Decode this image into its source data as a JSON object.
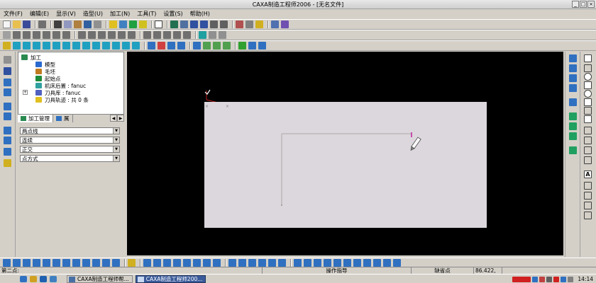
{
  "window": {
    "title": "CAXA制造工程师2006 - [无名文件]"
  },
  "menu": [
    "文件(F)",
    "编辑(E)",
    "显示(V)",
    "造型(U)",
    "加工(N)",
    "工具(T)",
    "设置(S)",
    "帮助(H)"
  ],
  "tree": {
    "root": "加工",
    "items": [
      {
        "label": "模型",
        "icon": "model-icon",
        "color": "#2a6ad0"
      },
      {
        "label": "毛坯",
        "icon": "blank-icon",
        "color": "#c07b20"
      },
      {
        "label": "起始点",
        "icon": "start-point-icon",
        "color": "#1e8a3a"
      },
      {
        "label": "机床后置 : fanuc",
        "icon": "machine-post-icon",
        "color": "#30a0a0"
      },
      {
        "label": "刀具库 : fanuc",
        "icon": "tool-library-icon",
        "color": "#5060c0"
      },
      {
        "label": "刀具轨迹 : 共 0 条",
        "icon": "toolpath-icon",
        "color": "#e0c020"
      }
    ],
    "tabs": [
      "加工管理",
      "属"
    ]
  },
  "options": {
    "line_type": "两点线",
    "mode": "连续",
    "constraint": "正交",
    "method": "点方式"
  },
  "statusbar": {
    "prompt": "第二点:",
    "hint": "操作指导",
    "point_mode": "缺省点",
    "coords": "86.422,"
  },
  "taskbar": {
    "items": [
      "CAXA制造工程师帮...",
      "CAXA制造工程师200..."
    ],
    "clock": "14:14"
  },
  "colors": {
    "viewport": "#000000",
    "sheet": "#dcd7dc",
    "accent": "#3a5a9a"
  }
}
